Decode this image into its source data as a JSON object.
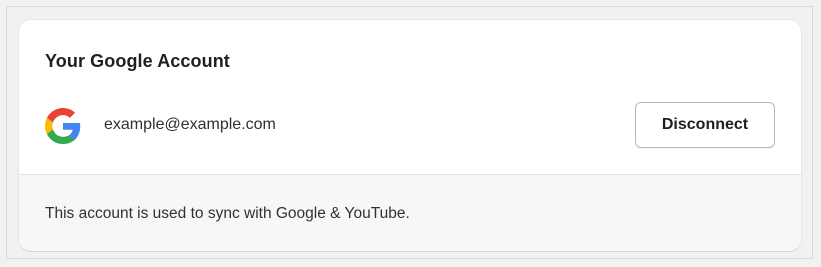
{
  "card": {
    "title": "Your Google Account",
    "account": {
      "icon": "google-logo-icon",
      "email": "example@example.com"
    },
    "disconnect_label": "Disconnect",
    "footer_text": "This account is used to sync with Google & YouTube."
  },
  "colors": {
    "google_blue": "#4285F4",
    "google_red": "#EA4335",
    "google_yellow": "#FBBC05",
    "google_green": "#34A853"
  }
}
